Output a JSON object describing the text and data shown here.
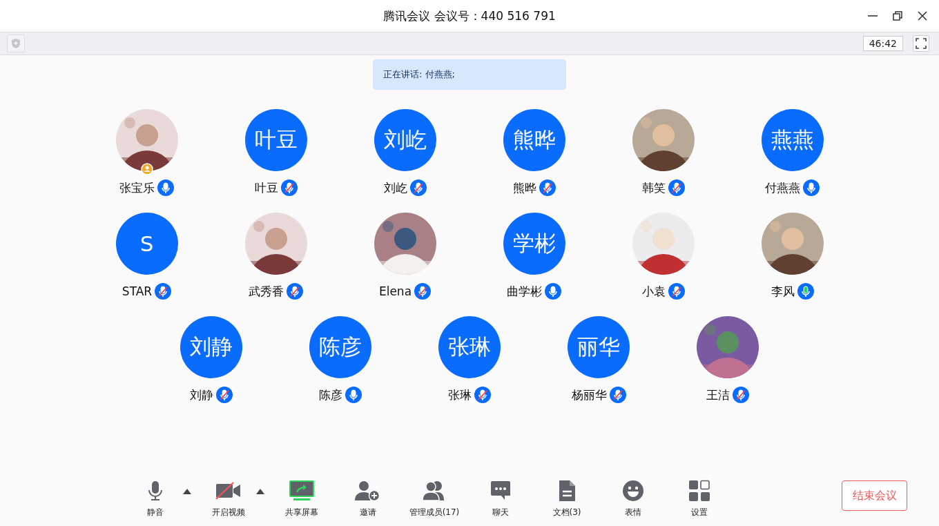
{
  "window": {
    "title": "腾讯会议 会议号：440 516 791"
  },
  "timer": "46:42",
  "speaking_banner": "正在讲话: 付燕燕;",
  "participants": [
    {
      "name": "张宝乐",
      "host": true,
      "muted": false,
      "speaking": false
    },
    {
      "name": "叶豆",
      "avatar": {
        "kind": "initials",
        "text": "叶豆"
      },
      "host": false,
      "muted": true,
      "speaking": false
    },
    {
      "name": "刘屹",
      "avatar": {
        "kind": "initials",
        "text": "刘屹"
      },
      "host": false,
      "muted": true,
      "speaking": false
    },
    {
      "name": "熊晔",
      "avatar": {
        "kind": "initials",
        "text": "熊晔"
      },
      "host": false,
      "muted": true,
      "speaking": false
    },
    {
      "name": "韩笑",
      "host": false,
      "muted": true,
      "speaking": false
    },
    {
      "name": "付燕燕",
      "avatar": {
        "kind": "initials",
        "text": "燕燕"
      },
      "host": false,
      "muted": false,
      "speaking": false
    },
    {
      "name": "STAR",
      "avatar": {
        "kind": "initials",
        "text": "S"
      },
      "host": false,
      "muted": true,
      "speaking": false
    },
    {
      "name": "武秀香",
      "host": false,
      "muted": true,
      "speaking": false
    },
    {
      "name": "Elena",
      "host": false,
      "muted": true,
      "speaking": false
    },
    {
      "name": "曲学彬",
      "avatar": {
        "kind": "initials",
        "text": "学彬"
      },
      "host": false,
      "muted": false,
      "speaking": false
    },
    {
      "name": "小袁",
      "host": false,
      "muted": true,
      "speaking": false
    },
    {
      "name": "李风",
      "host": false,
      "muted": false,
      "speaking": true
    },
    {
      "name": "刘静",
      "avatar": {
        "kind": "initials",
        "text": "刘静"
      },
      "host": false,
      "muted": true,
      "speaking": false
    },
    {
      "name": "陈彦",
      "avatar": {
        "kind": "initials",
        "text": "陈彦"
      },
      "host": false,
      "muted": false,
      "speaking": false
    },
    {
      "name": "张琳",
      "avatar": {
        "kind": "initials",
        "text": "张琳"
      },
      "host": false,
      "muted": true,
      "speaking": false
    },
    {
      "name": "杨丽华",
      "avatar": {
        "kind": "initials",
        "text": "丽华"
      },
      "host": false,
      "muted": true,
      "speaking": false
    },
    {
      "name": "王洁",
      "host": false,
      "muted": true,
      "speaking": false
    }
  ],
  "toolbar": [
    {
      "kind": "mic",
      "label": "静音",
      "menu": true
    },
    {
      "kind": "video-off",
      "label": "开启视频",
      "menu": true
    },
    {
      "kind": "share",
      "label": "共享屏幕",
      "menu": false
    },
    {
      "kind": "invite",
      "label": "邀请",
      "menu": false
    },
    {
      "kind": "members",
      "label": "管理成员(17)",
      "menu": false
    },
    {
      "kind": "chat",
      "label": "聊天",
      "menu": false
    },
    {
      "kind": "docs",
      "label": "文档(3)",
      "menu": false
    },
    {
      "kind": "emoji",
      "label": "表情",
      "menu": false
    },
    {
      "kind": "settings",
      "label": "设置",
      "menu": false
    }
  ],
  "end_button": "结束会议"
}
